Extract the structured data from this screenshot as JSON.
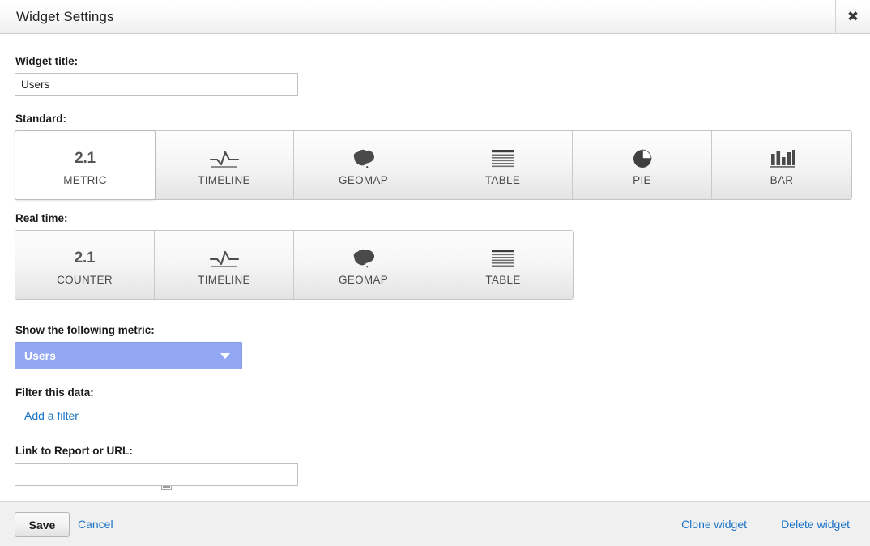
{
  "dialog": {
    "title": "Widget Settings",
    "close_icon": "close-icon"
  },
  "form": {
    "widget_title": {
      "label": "Widget title:",
      "value": "Users",
      "placeholder": ""
    },
    "standard": {
      "label": "Standard:",
      "selected": "METRIC",
      "tiles": [
        {
          "label": "METRIC",
          "icon": "metric-number-icon",
          "glyph": "2.1",
          "selected": true
        },
        {
          "label": "TIMELINE",
          "icon": "timeline-line-icon",
          "glyph": "",
          "selected": false
        },
        {
          "label": "GEOMAP",
          "icon": "geomap-australia-icon",
          "glyph": "",
          "selected": false
        },
        {
          "label": "TABLE",
          "icon": "table-rows-icon",
          "glyph": "",
          "selected": false
        },
        {
          "label": "PIE",
          "icon": "pie-chart-icon",
          "glyph": "",
          "selected": false
        },
        {
          "label": "BAR",
          "icon": "bar-chart-icon",
          "glyph": "",
          "selected": false
        }
      ]
    },
    "realtime": {
      "label": "Real time:",
      "selected": "",
      "tiles": [
        {
          "label": "COUNTER",
          "icon": "counter-number-icon",
          "glyph": "2.1",
          "selected": false
        },
        {
          "label": "TIMELINE",
          "icon": "timeline-line-icon",
          "glyph": "",
          "selected": false
        },
        {
          "label": "GEOMAP",
          "icon": "geomap-australia-icon",
          "glyph": "",
          "selected": false
        },
        {
          "label": "TABLE",
          "icon": "table-rows-icon",
          "glyph": "",
          "selected": false
        }
      ]
    },
    "metric": {
      "label": "Show the following metric:",
      "value": "Users",
      "arrow_icon": "chevron-down-icon"
    },
    "filter": {
      "label": "Filter this data:",
      "add_link": "Add a filter"
    },
    "link_report": {
      "label": "Link to Report or URL:",
      "help_icon": "report-document-icon",
      "value": "",
      "placeholder": ""
    }
  },
  "footer": {
    "save_label": "Save",
    "cancel_label": "Cancel",
    "clone_label": "Clone widget",
    "delete_label": "Delete widget"
  },
  "colors": {
    "accent_link": "#1a73c7",
    "select_bg": "#92a8f2",
    "footer_bg": "#f0f0f0",
    "tile_selected_bg": "#ffffff"
  }
}
